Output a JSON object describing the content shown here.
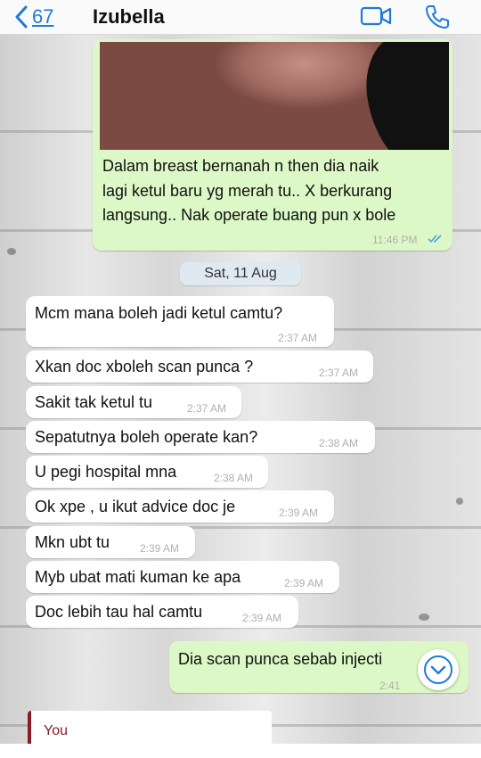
{
  "header": {
    "back_count": "67",
    "contact_name": "Izubella"
  },
  "outgoing_photo_message": {
    "lines": [
      "Dalam breast bernanah n then dia naik",
      "lagi ketul baru yg merah tu..  X berkurang",
      "langsung..  Nak operate buang pun x bole"
    ],
    "time": "11:46 PM",
    "status_icon": "double-check-icon"
  },
  "date_separator": "Sat, 11 Aug",
  "incoming_messages": [
    {
      "text": "Mcm mana boleh jadi ketul camtu?",
      "time": "2:37 AM"
    },
    {
      "text": "Xkan doc xboleh scan punca ?",
      "time": "2:37 AM"
    },
    {
      "text": "Sakit tak ketul tu",
      "time": "2:37 AM"
    },
    {
      "text": "Sepatutnya boleh operate kan?",
      "time": "2:38 AM"
    },
    {
      "text": "U pegi hospital mna",
      "time": "2:38 AM"
    },
    {
      "text": "Ok xpe , u ikut advice doc je",
      "time": "2:39 AM"
    },
    {
      "text": "Mkn ubt tu",
      "time": "2:39 AM"
    },
    {
      "text": "Myb ubat mati kuman ke apa",
      "time": "2:39 AM"
    },
    {
      "text": "Doc lebih tau hal camtu",
      "time": "2:39 AM"
    }
  ],
  "last_outgoing": {
    "text": "Dia scan punca sebab injecti",
    "time": "2:41"
  },
  "reply_preview": {
    "sender": "You"
  },
  "colors": {
    "accent": "#1f7bd6",
    "outgoing_bubble": "#dcf8c6",
    "incoming_bubble": "#ffffff",
    "reply_accent": "#8b1a2a"
  }
}
